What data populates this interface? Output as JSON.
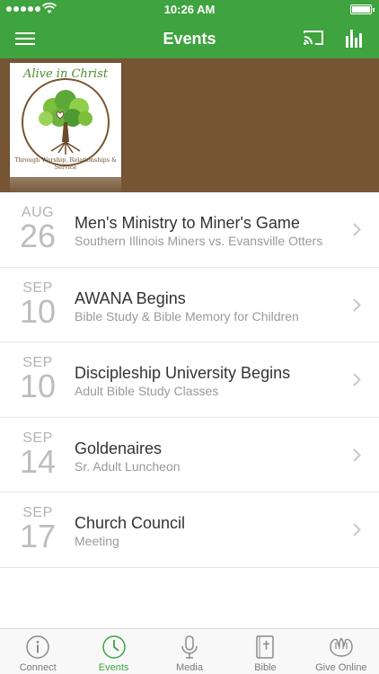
{
  "colors": {
    "accent": "#3fa33f",
    "banner": "#765535"
  },
  "status_bar": {
    "time": "10:26 AM"
  },
  "nav": {
    "title": "Events"
  },
  "logo": {
    "top_text": "Alive in Christ",
    "bottom_text": "Through Worship, Relationships & Service"
  },
  "events": [
    {
      "month": "AUG",
      "day": "26",
      "title": "Men's Ministry to Miner's Game",
      "subtitle": "Southern Illinois Miners vs. Evansville Otters"
    },
    {
      "month": "SEP",
      "day": "10",
      "title": "AWANA Begins",
      "subtitle": "Bible Study & Bible Memory for Children"
    },
    {
      "month": "SEP",
      "day": "10",
      "title": "Discipleship University Begins",
      "subtitle": "Adult Bible Study Classes"
    },
    {
      "month": "SEP",
      "day": "14",
      "title": "Goldenaires",
      "subtitle": "Sr. Adult Luncheon"
    },
    {
      "month": "SEP",
      "day": "17",
      "title": "Church Council",
      "subtitle": "Meeting"
    }
  ],
  "tabs": [
    {
      "label": "Connect",
      "icon": "info-icon"
    },
    {
      "label": "Events",
      "icon": "clock-icon"
    },
    {
      "label": "Media",
      "icon": "microphone-icon"
    },
    {
      "label": "Bible",
      "icon": "bible-icon"
    },
    {
      "label": "Give Online",
      "icon": "hands-icon"
    }
  ]
}
